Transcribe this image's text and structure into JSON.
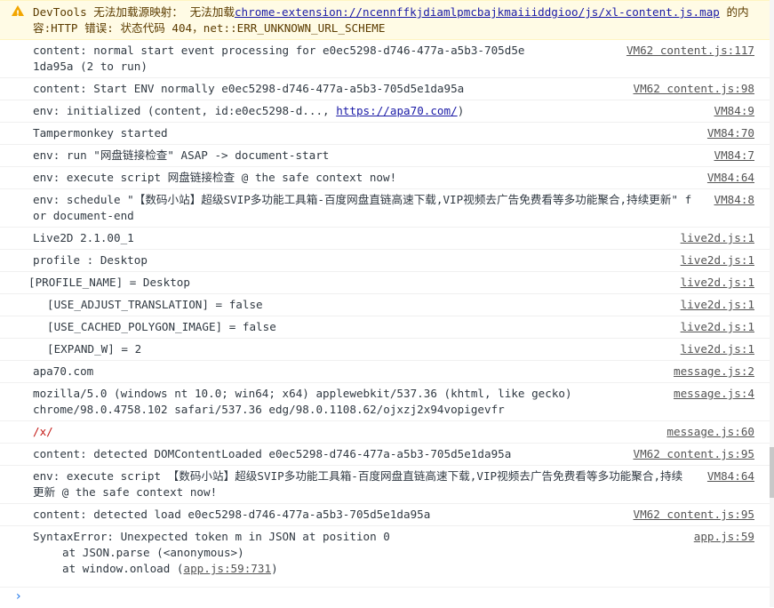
{
  "warning": {
    "prefix": "DevTools 无法加载源映射： 无法加载",
    "link": "chrome-extension://ncennffkjdiamlpmcbajkmaiiiddgioo/js/xl-content.js.map",
    "suffix": " 的内容:HTTP 错误: 状态代码 404，net::ERR_UNKNOWN_URL_SCHEME"
  },
  "rows": [
    {
      "text": "content: normal start event processing for e0ec5298-d746-477a-a5b3-705d5e1da95a (2 to run)",
      "source": "VM62 content.js:117"
    },
    {
      "text": "content: Start ENV normally e0ec5298-d746-477a-a5b3-705d5e1da95a",
      "source": "VM62 content.js:98"
    },
    {
      "text_before": "env: initialized (content, id:e0ec5298-d..., ",
      "link": "https://apa70.com/",
      "text_after": ")",
      "source": "VM84:9"
    },
    {
      "text": "Tampermonkey started",
      "source": "VM84:70"
    },
    {
      "text": "env: run \"网盘链接检查\" ASAP -> document-start",
      "source": "VM84:7"
    },
    {
      "text": "env: execute script 网盘链接检查 @ the safe context now!",
      "source": "VM84:64"
    },
    {
      "text": "env: schedule \"【数码小站】超级SVIP多功能工具箱-百度网盘直链高速下载,VIP视频去广告免费看等多功能聚合,持续更新\" for document-end",
      "source": "VM84:8"
    },
    {
      "text": "Live2D 2.1.00_1",
      "source": "live2d.js:1"
    },
    {
      "text": "profile : Desktop",
      "source": "live2d.js:1"
    },
    {
      "text": "[PROFILE_NAME] = Desktop",
      "source": "live2d.js:1"
    },
    {
      "text": "[USE_ADJUST_TRANSLATION] = false",
      "source": "live2d.js:1"
    },
    {
      "text": "[USE_CACHED_POLYGON_IMAGE] = false",
      "source": "live2d.js:1"
    },
    {
      "text": "[EXPAND_W] = 2",
      "source": "live2d.js:1"
    },
    {
      "text": "apa70.com",
      "source": "message.js:2"
    },
    {
      "text": "mozilla/5.0 (windows nt 10.0; win64; x64) applewebkit/537.36 (khtml, like gecko) chrome/98.0.4758.102 safari/537.36 edg/98.0.1108.62/ojxzj2x94vopigevfr",
      "source": "message.js:4"
    },
    {
      "text": "/x/",
      "source": "message.js:60"
    },
    {
      "text": "content: detected DOMContentLoaded e0ec5298-d746-477a-a5b3-705d5e1da95a",
      "source": "VM62 content.js:95"
    },
    {
      "text": "env: execute script 【数码小站】超级SVIP多功能工具箱-百度网盘直链高速下载,VIP视频去广告免费看等多功能聚合,持续更新 @ the safe context now!",
      "source": "VM84:64"
    },
    {
      "text": "content: detected load e0ec5298-d746-477a-a5b3-705d5e1da95a",
      "source": "VM62 content.js:95"
    }
  ],
  "error": {
    "message": "SyntaxError: Unexpected token m in JSON at position 0",
    "source": "app.js:59",
    "stack1": "at JSON.parse (<anonymous>)",
    "stack2_before": "at window.onload (",
    "stack2_link": "app.js:59:731",
    "stack2_after": ")"
  },
  "prompt": {
    "chevron": "›"
  },
  "colors": {
    "link": "#1a1aa6",
    "warning_bg": "#fffbe5",
    "error_text": "#ff0000",
    "regex": "#c41a16",
    "prompt": "#1a73e8"
  }
}
